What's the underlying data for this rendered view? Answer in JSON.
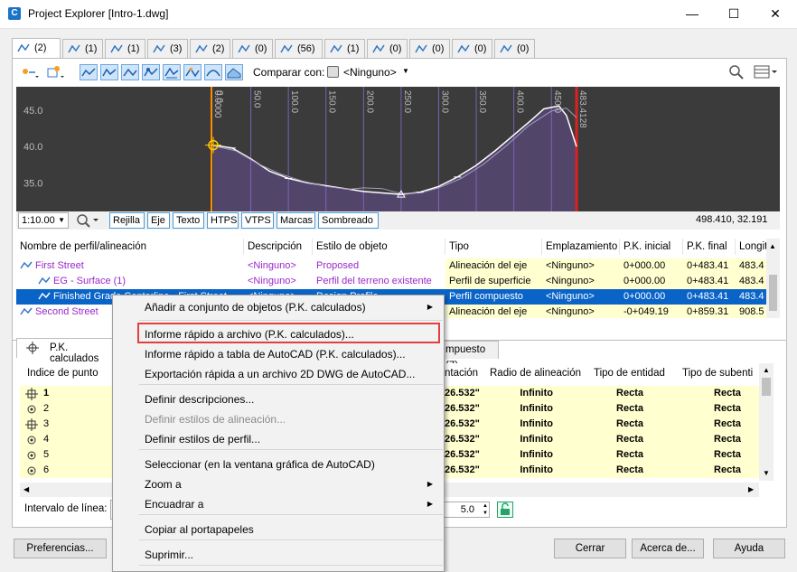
{
  "window": {
    "title": "Project Explorer [Intro-1.dwg]",
    "app_icon": "C"
  },
  "tabs": [
    {
      "icon": "alignment-icon",
      "count": "(2)"
    },
    {
      "icon": "surface-icon",
      "count": "(1)"
    },
    {
      "icon": "parcel-icon",
      "count": "(1)"
    },
    {
      "icon": "pipe-icon",
      "count": "(3)"
    },
    {
      "icon": "structure-icon",
      "count": "(2)"
    },
    {
      "icon": "feature-line-icon",
      "count": "(0)"
    },
    {
      "icon": "corridor-icon",
      "count": "(56)"
    },
    {
      "icon": "assembly-icon",
      "count": "(1)"
    },
    {
      "icon": "subassembly-icon",
      "count": "(0)"
    },
    {
      "icon": "section-icon",
      "count": "(0)"
    },
    {
      "icon": "point-group-icon",
      "count": "(0)"
    },
    {
      "icon": "view-frame-icon",
      "count": "(0)"
    }
  ],
  "toolbar": {
    "compare_label": "Comparar con:",
    "compare_value": "<Ninguno>"
  },
  "chart_data": {
    "type": "line",
    "y_ticks": [
      "45.0",
      "40.0",
      "35.0"
    ],
    "x_ticks": [
      "0.0000",
      "0.0",
      "50.0",
      "100.0",
      "150.0",
      "200.0",
      "250.0",
      "300.0",
      "350.0",
      "400.0",
      "450.0",
      "483.4128"
    ],
    "series": [
      {
        "values": [
          [
            0,
            40.2
          ],
          [
            25,
            39.8
          ],
          [
            50,
            38.3
          ],
          [
            75,
            36.6
          ],
          [
            100,
            35.6
          ],
          [
            125,
            35.0
          ],
          [
            150,
            34.6
          ],
          [
            175,
            34.2
          ],
          [
            200,
            33.8
          ],
          [
            225,
            33.6
          ],
          [
            250,
            33.4
          ],
          [
            275,
            33.7
          ],
          [
            300,
            34.5
          ],
          [
            325,
            35.8
          ],
          [
            350,
            37.4
          ],
          [
            375,
            39.4
          ],
          [
            400,
            41.6
          ],
          [
            425,
            43.8
          ],
          [
            440,
            45.2
          ],
          [
            460,
            45.6
          ],
          [
            470,
            44.3
          ],
          [
            483.4,
            40.0
          ]
        ]
      },
      {
        "values": [
          [
            0,
            40.1
          ],
          [
            30,
            39.4
          ],
          [
            60,
            37.6
          ],
          [
            90,
            36.2
          ],
          [
            120,
            35.2
          ],
          [
            150,
            34.5
          ],
          [
            180,
            34.1
          ],
          [
            200,
            34.3
          ],
          [
            225,
            34.2
          ],
          [
            250,
            33.5
          ],
          [
            275,
            33.6
          ],
          [
            300,
            34.3
          ],
          [
            330,
            35.6
          ],
          [
            360,
            37.6
          ],
          [
            390,
            40.1
          ],
          [
            420,
            42.9
          ],
          [
            450,
            44.9
          ],
          [
            470,
            45.3
          ],
          [
            483.4,
            44.0
          ]
        ]
      }
    ],
    "ylim": [
      32,
      48
    ],
    "xlim": [
      -15,
      505
    ]
  },
  "chart_bar": {
    "scale": "1:10.00",
    "buttons": [
      "Rejilla",
      "Eje",
      "Texto",
      "HTPS",
      "VTPS",
      "Marcas",
      "Sombreado"
    ],
    "coords": "498.410, 32.191"
  },
  "profile_table": {
    "headers": [
      "Nombre de perfil/alineación",
      "Descripción",
      "Estilo de objeto",
      "Tipo",
      "Emplazamiento",
      "P.K. inicial",
      "P.K. final",
      "Longit"
    ],
    "rows": [
      [
        "First Street",
        "",
        "",
        "Alineación del eje",
        "<Ninguno>",
        "0+000.00",
        "0+483.41",
        "483.4"
      ],
      [
        "EG - Surface (1)",
        "<Ninguno>",
        "Perfil del terreno existente",
        "Perfil de superficie",
        "<Ninguno>",
        "0+000.00",
        "0+483.41",
        "483.4"
      ],
      [
        "Finished Grade Centerline - First Street",
        "<Ninguno>",
        "Design Profile",
        "Perfil compuesto",
        "<Ninguno>",
        "0+000.00",
        "0+483.41",
        "483.4"
      ],
      [
        "Second Street",
        "",
        "",
        "Alineación del eje",
        "<Ninguno>",
        "-0+049.19",
        "0+859.31",
        "908.5"
      ]
    ],
    "row0_desc": "<Ninguno>",
    "row0_style": "Proposed"
  },
  "lower": {
    "tab1_label": "P.K. calculados",
    "tab2_label": "mpuesto (7)",
    "headers": [
      "Índice de punto",
      "ntación",
      "Radio de alineación",
      "Tipo de entidad",
      "Tipo de subenti"
    ],
    "rows": [
      [
        "1",
        "26.532\"",
        "Infinito",
        "Recta",
        "Recta"
      ],
      [
        "2",
        "26.532\"",
        "Infinito",
        "Recta",
        "Recta"
      ],
      [
        "3",
        "26.532\"",
        "Infinito",
        "Recta",
        "Recta"
      ],
      [
        "4",
        "26.532\"",
        "Infinito",
        "Recta",
        "Recta"
      ],
      [
        "5",
        "26.532\"",
        "Infinito",
        "Recta",
        "Recta"
      ],
      [
        "6",
        "26.532\"",
        "Infinito",
        "Recta",
        "Recta"
      ]
    ],
    "interval_label": "Intervalo de línea:",
    "interval_value": "5.0"
  },
  "buttons": {
    "prefs": "Preferencias...",
    "close": "Cerrar",
    "about": "Acerca de...",
    "help": "Ayuda"
  },
  "context_menu": [
    {
      "label": "Añadir a conjunto de objetos (P.K. calculados)",
      "submenu": true
    },
    {
      "label": "Informe rápido a archivo (P.K. calculados)...",
      "highlighted": true
    },
    {
      "label": "Informe rápido a tabla de AutoCAD (P.K. calculados)..."
    },
    {
      "label": "Exportación rápida a un archivo 2D DWG de AutoCAD..."
    },
    {
      "label": "Definir descripciones..."
    },
    {
      "label": "Definir estilos de alineación...",
      "disabled": true
    },
    {
      "label": "Definir estilos de perfil..."
    },
    {
      "label": "Seleccionar (en la ventana gráfica de AutoCAD)"
    },
    {
      "label": "Zoom a",
      "submenu": true
    },
    {
      "label": "Encuadrar a",
      "submenu": true
    },
    {
      "label": "Copiar al portapapeles"
    },
    {
      "label": "Suprimir..."
    }
  ]
}
